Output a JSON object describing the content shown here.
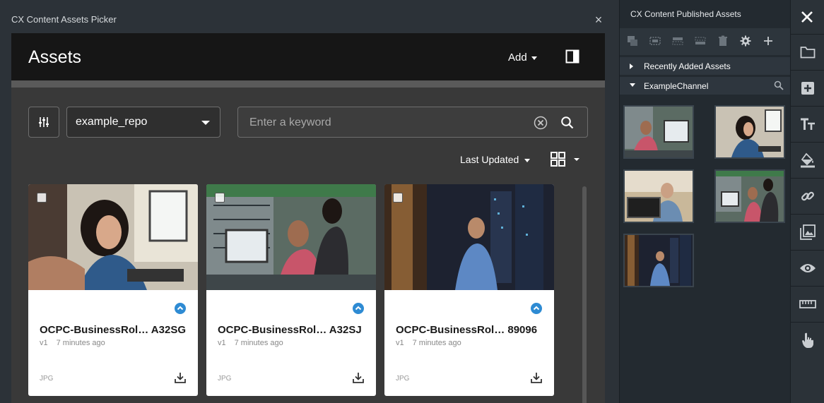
{
  "picker": {
    "title": "CX Content Assets Picker",
    "close_label": "×",
    "header_title": "Assets",
    "add_label": "Add",
    "repo_value": "example_repo",
    "search_placeholder": "Enter a keyword",
    "sort_label": "Last Updated"
  },
  "cards": [
    {
      "name": "OCPC-BusinessRol… A32SG",
      "version": "v1",
      "age": "7 minutes ago",
      "type": "JPG"
    },
    {
      "name": "OCPC-BusinessRol… A32SJ",
      "version": "v1",
      "age": "7 minutes ago",
      "type": "JPG"
    },
    {
      "name": "OCPC-BusinessRol… 89096",
      "version": "v1",
      "age": "7 minutes ago",
      "type": "JPG"
    }
  ],
  "right_panel": {
    "title": "CX Content Published Assets",
    "sections": [
      {
        "label": "Recently Added Assets",
        "expanded": false
      },
      {
        "label": "ExampleChannel",
        "expanded": true
      }
    ]
  },
  "vertical_toolbar": [
    "folder-icon",
    "add-box-icon",
    "text-size-icon",
    "paint-bucket-icon",
    "link-icon",
    "image-icon",
    "eye-icon",
    "ruler-icon",
    "touch-icon"
  ],
  "colors": {
    "accent": "#2e8bd3",
    "panel_bg": "#393939",
    "header_bg": "#161616"
  }
}
